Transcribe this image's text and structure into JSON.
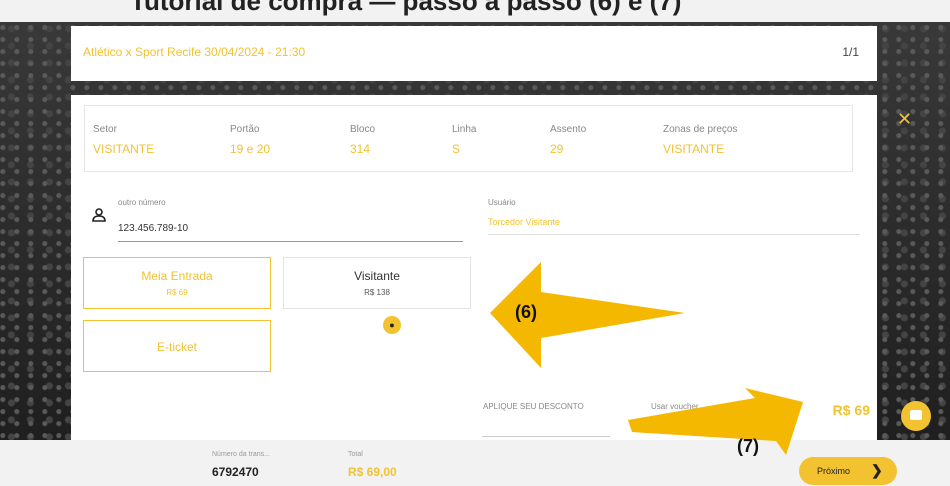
{
  "header_strip": "Tutorial de compra — passo a passo (6) e (7)",
  "event": {
    "title": "Atlético x Sport Recife 30/04/2024 - 21:30",
    "page": "1/1"
  },
  "ticket_info": [
    {
      "label": "Setor",
      "value": "VISITANTE"
    },
    {
      "label": "Portão",
      "value": "19 e 20"
    },
    {
      "label": "Bloco",
      "value": "314"
    },
    {
      "label": "Linha",
      "value": "S"
    },
    {
      "label": "Assento",
      "value": "29"
    },
    {
      "label": "Zonas de preços",
      "value": "VISITANTE"
    }
  ],
  "document": {
    "label": "outro número",
    "value": "123.456.789-10"
  },
  "user": {
    "label": "Usuário",
    "value": "Torcedor Visitante"
  },
  "ticket_types": [
    {
      "name": "Meia Entrada",
      "price": "R$ 69",
      "selected": true
    },
    {
      "name": "Visitante",
      "price": "R$ 138",
      "selected": false
    }
  ],
  "delivery": {
    "name": "E-ticket",
    "selected": true
  },
  "discount": {
    "label": "APLIQUE SEU DESCONTO",
    "voucher_label": "Usar voucher"
  },
  "price_total": "R$ 69",
  "footer": {
    "trans_label": "Número da trans...",
    "trans_value": "6792470",
    "total_label": "Total",
    "total_value": "R$ 69,00",
    "next_label": "Próximo"
  },
  "annotations": {
    "step6": "(6)",
    "step7": "(7)"
  },
  "colors": {
    "accent": "#f2c230",
    "arrow": "#f5b800"
  },
  "icons": [
    "close-icon",
    "person-icon",
    "tag-icon",
    "voucher-icon",
    "chat-icon",
    "chevron-right-icon"
  ]
}
